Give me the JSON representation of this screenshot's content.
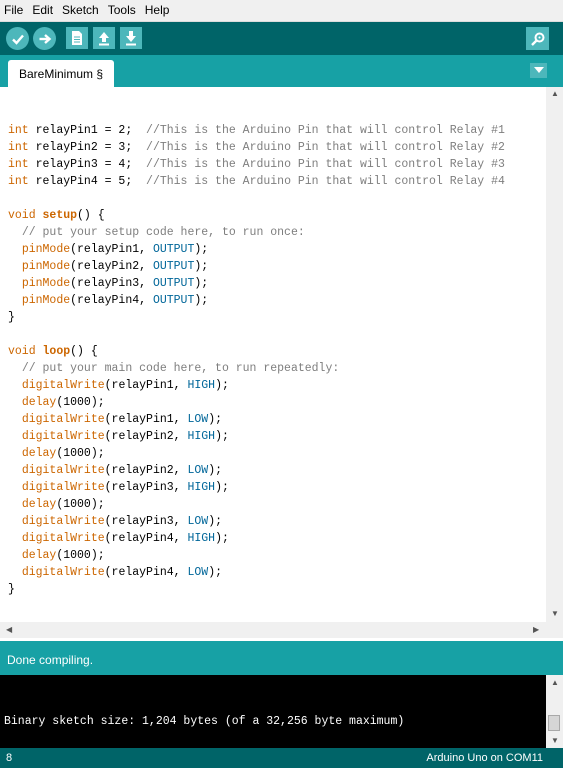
{
  "menu": [
    "File",
    "Edit",
    "Sketch",
    "Tools",
    "Help"
  ],
  "toolbar": {
    "icons": [
      "verify-checkmark-icon",
      "upload-arrow-icon",
      "new-document-icon",
      "open-up-arrow-icon",
      "save-down-arrow-icon",
      "serial-monitor-magnifier-icon"
    ]
  },
  "tab": {
    "label": "BareMinimum §"
  },
  "code_lines": [
    "",
    "int relayPin1 = 2;  //This is the Arduino Pin that will control Relay #1",
    "int relayPin2 = 3;  //This is the Arduino Pin that will control Relay #2",
    "int relayPin3 = 4;  //This is the Arduino Pin that will control Relay #3",
    "int relayPin4 = 5;  //This is the Arduino Pin that will control Relay #4",
    "",
    "void setup() {",
    "  // put your setup code here, to run once:",
    "  pinMode(relayPin1, OUTPUT);",
    "  pinMode(relayPin2, OUTPUT);",
    "  pinMode(relayPin3, OUTPUT);",
    "  pinMode(relayPin4, OUTPUT);",
    "}",
    "",
    "void loop() {",
    "  // put your main code here, to run repeatedly:",
    "  digitalWrite(relayPin1, HIGH);",
    "  delay(1000);",
    "  digitalWrite(relayPin1, LOW);",
    "  digitalWrite(relayPin2, HIGH);",
    "  delay(1000);",
    "  digitalWrite(relayPin2, LOW);",
    "  digitalWrite(relayPin3, HIGH);",
    "  delay(1000);",
    "  digitalWrite(relayPin3, LOW);",
    "  digitalWrite(relayPin4, HIGH);",
    "  delay(1000);",
    "  digitalWrite(relayPin4, LOW);",
    "}"
  ],
  "status": {
    "message": "Done compiling."
  },
  "console": {
    "output": "Binary sketch size: 1,204 bytes (of a 32,256 byte maximum)"
  },
  "footer": {
    "line_number": "8",
    "board_port": "Arduino Uno on COM11"
  },
  "colors": {
    "toolbar_bg": "#006468",
    "tabstrip_bg": "#17a1a5",
    "button_bg": "#4db7bb",
    "keyword": "#cc6600",
    "constant": "#006699",
    "comment": "#7e7e7e"
  }
}
